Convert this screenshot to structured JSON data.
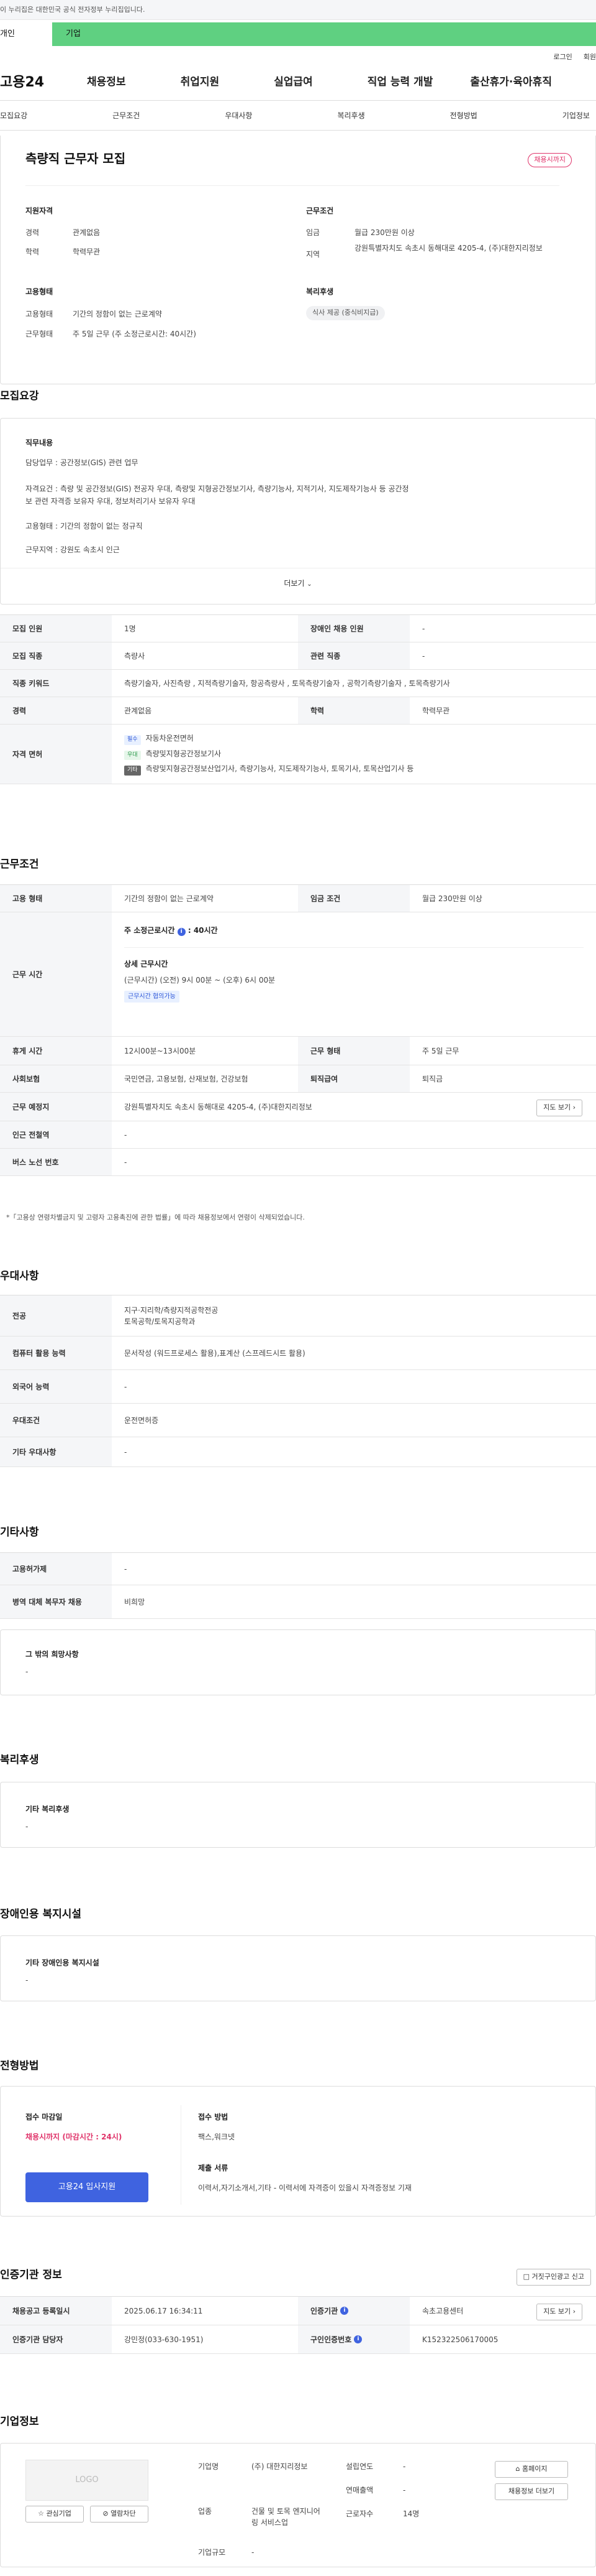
{
  "gov_notice": "이 누리집은 대한민국 공식 전자정부 누리집입니다.",
  "user_tabs": [
    "개인",
    "기업"
  ],
  "top_links": [
    "로그인",
    "회원"
  ],
  "logo": "고용24",
  "gnb": [
    "채용정보",
    "취업지원",
    "실업급여",
    "직업 능력 개발",
    "출산휴가·육아휴직"
  ],
  "subnav": [
    "모집요강",
    "근무조건",
    "우대사항",
    "복리후생",
    "전형방법",
    "기업정보"
  ],
  "job": {
    "title": "측량직 근무자 모집",
    "status_badge": "채용시까지",
    "qual_title": "지원자격",
    "career_label": "경력",
    "career_value": "관계없음",
    "edu_label": "학력",
    "edu_value": "학력무관",
    "cond_title": "근무조건",
    "wage_label": "임금",
    "wage_value": "월급 230만원 이상",
    "region_label": "지역",
    "region_value": "강원특별자치도 속초시 동해대로 4205-4, (주)대한지리정보",
    "emp_title": "고용형태",
    "emptype_label": "고용형태",
    "emptype_value": "기간의 정함이 없는 근로계약",
    "worktype_label": "근무형태",
    "worktype_value": "주 5일 근무 (주 소정근로시간: 40시간)",
    "welfare_title": "복리후생",
    "welfare_chip": "식사 제공 (중식비지급)"
  },
  "recruit": {
    "heading": "모집요강",
    "duty_title": "직무내용",
    "duty_lines": [
      "담당업무 : 공간정보(GIS) 관련 업무",
      "자격요건 : 측량 및 공간정보(GIS) 전공자 우대, 측량및 지형공간정보기사, 측량기능사, 지적기사, 지도제작기능사 등 공간정",
      "보 관련 자격증 보유자 우대, 정보처리기사 보유자 우대",
      "고용형태 : 기간의 정함이 없는 정규직",
      "근무지역 : 강원도 속초시 인근"
    ],
    "more": "더보기",
    "rows": [
      {
        "k1": "모집 인원",
        "v1": "1명",
        "k2": "장애인 채용 인원",
        "v2": "-"
      },
      {
        "k1": "모집 직종",
        "v1": "측량사",
        "k2": "관련 직종",
        "v2": "-"
      },
      {
        "k1": "직종 키워드",
        "v1": "측량기술자, 사진측량 , 지적측량기술자, 항공측량사 , 토목측량기술자 , 공학기측량기술자 , 토목측량기사"
      },
      {
        "k1": "경력",
        "v1": "관계없음",
        "k2": "학력",
        "v2": "학력무관"
      }
    ],
    "license_label": "자격 면허",
    "licenses": [
      {
        "tag": "필수",
        "text": "자동차운전면허"
      },
      {
        "tag": "우대",
        "text": "측량및지형공간정보기사"
      },
      {
        "tag": "기타",
        "text": "측량및지형공간정보산업기사, 측량기능사, 지도제작기능사, 토목기사, 토목산업기사 등"
      }
    ]
  },
  "work": {
    "heading": "근무조건",
    "emptype_label": "고용 형태",
    "emptype_value": "기간의 정함이 없는 근로계약",
    "wage_label": "임금 조건",
    "wage_value": "월급 230만원 이상",
    "hours_label": "근무 시간",
    "weekly_hours": "주 소정근로시간",
    "weekly_hours_val": ": 40시간",
    "detail_title": "상세 근무시간",
    "detail_text": "(근무시간) (오전) 9시 00분 ~ (오후) 6시 00분",
    "detail_tag": "근무시간 협의가능",
    "break_label": "휴게 시간",
    "break_value": "12시00분~13시00분",
    "form_label": "근무 형태",
    "form_value": "주 5일 근무",
    "insurance_label": "사회보험",
    "insurance_value": "국민연금, 고용보험, 산재보험, 건강보험",
    "severance_label": "퇴직급여",
    "severance_value": "퇴직금",
    "place_label": "근무 예정지",
    "place_value": "강원특별자치도 속초시 동해대로 4205-4, (주)대한지리정보",
    "map_btn": "지도 보기",
    "subway_label": "인근 전철역",
    "subway_value": "-",
    "bus_label": "버스 노선 번호",
    "bus_value": "-",
    "notice": "*「고용상 연령차별금지 및 고령자 고용촉진에 관한 법률」에 따라 채용정보에서 연령이 삭제되었습니다."
  },
  "pref": {
    "heading": "우대사항",
    "rows": [
      {
        "k": "전공",
        "v": [
          "지구·지리학/측량지적공학전공",
          "토목공학/토목지공학과"
        ]
      },
      {
        "k": "컴퓨터 활용 능력",
        "v": [
          "문서작성 (워드프로세스 활용),표계산 (스프레드시트 활용)"
        ]
      },
      {
        "k": "외국어 능력",
        "v": [
          "-"
        ]
      },
      {
        "k": "우대조건",
        "v": [
          "운전면허증"
        ]
      },
      {
        "k": "기타 우대사항",
        "v": [
          "-"
        ]
      }
    ]
  },
  "etc": {
    "heading": "기타사항",
    "rows": [
      {
        "k": "고용허가제",
        "v": "-"
      },
      {
        "k": "병역 대체 복무자 채용",
        "v": "비희망"
      }
    ],
    "other_title": "그 밖의 희망사항",
    "other_value": "-"
  },
  "welfare": {
    "heading": "복리후생",
    "title": "기타 복리후생",
    "value": "-"
  },
  "disabled": {
    "heading": "장애인용 복지시설",
    "title": "기타 장애인용 복지시설",
    "value": "-"
  },
  "apply": {
    "heading": "전형방법",
    "deadline_title": "접수 마감일",
    "deadline_value": "채용시까지 (마감시간 : 24시)",
    "apply_btn": "고용24 입사지원",
    "method_title": "접수 방법",
    "method_value": "팩스,워크넷",
    "docs_title": "제출 서류",
    "docs_value": "이력서,자기소개서,기타 - 이력서에 자격증이 있을시 자격증정보 기재"
  },
  "cert": {
    "heading": "인증기관 정보",
    "report_btn": "거짓구인광고 신고",
    "rows": [
      {
        "k1": "채용공고 등록일시",
        "v1": "2025.06.17 16:34:11",
        "k2": "인증기관",
        "v2": "속초고용센터",
        "btn": "지도 보기"
      },
      {
        "k1": "인증기관 담당자",
        "v1": "강민정(033-630-1951)",
        "k2": "구인인증번호",
        "v2": "K152322506170005"
      }
    ]
  },
  "company": {
    "heading": "기업정보",
    "logo_text": "LOGO",
    "fav_btn": "관심기업",
    "block_btn": "열람차단",
    "name_label": "기업명",
    "name_value": "(주) 대한지리정보",
    "industry_label": "업종",
    "industry_value": "건물 및 토목 엔지니어링 서비스업",
    "size_label": "기업규모",
    "size_value": "-",
    "founded_label": "설립연도",
    "founded_value": "-",
    "sales_label": "연매출액",
    "sales_value": "-",
    "staff_label": "근로자수",
    "staff_value": "14명",
    "home_btn": "홈페이지",
    "jobs_btn": "채용정보 더보기"
  },
  "colors": {
    "accent": "#5fd081",
    "primary": "#3f63e0",
    "danger": "#e0346a"
  }
}
